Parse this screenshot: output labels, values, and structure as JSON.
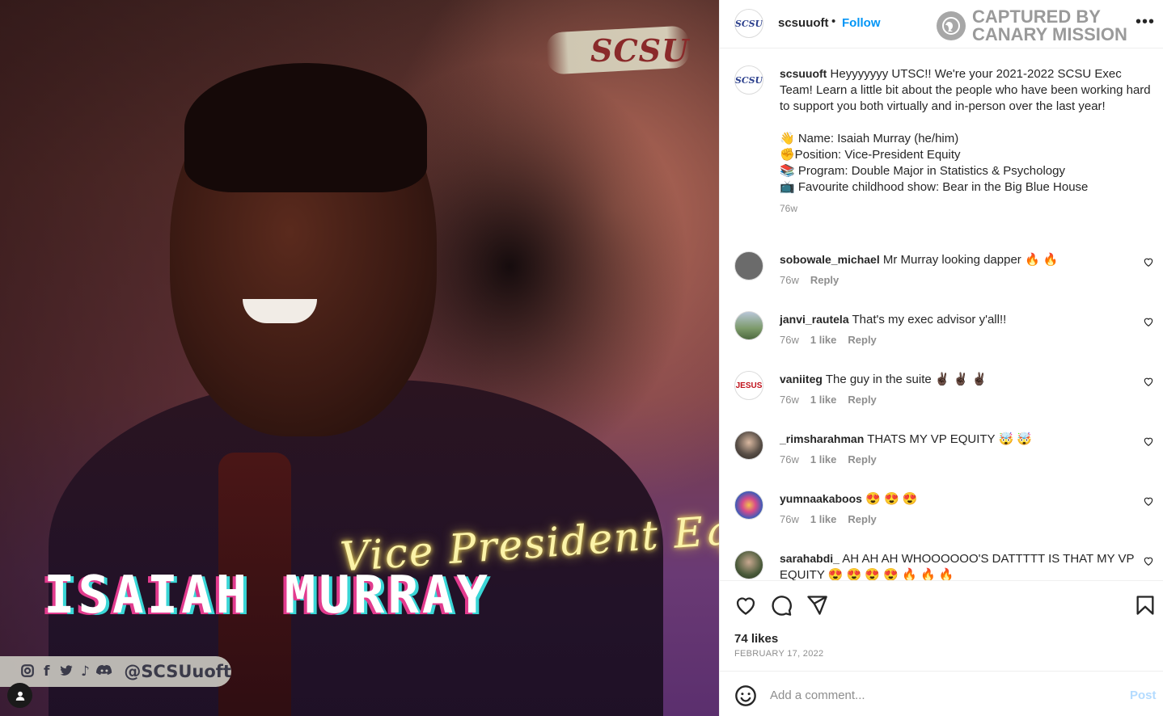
{
  "photo": {
    "logo_text": "SCSU",
    "role_text": "Vice President Equity",
    "name_text": "ISAIAH MURRAY",
    "social_handle": "@SCSUuoft",
    "social_icons": [
      "instagram-icon",
      "facebook-icon",
      "twitter-icon",
      "tiktok-icon",
      "discord-icon"
    ]
  },
  "header": {
    "avatar_text": "SCSU",
    "username": "scsuuoft",
    "separator": "•",
    "follow_label": "Follow",
    "watermark_line1": "CAPTURED BY",
    "watermark_line2": "CANARY MISSION",
    "more_label": "•••"
  },
  "caption": {
    "username": "scsuuoft",
    "text": "Heyyyyyyy UTSC!! We're your 2021-2022 SCSU Exec Team! Learn a little bit about the people who have been working hard to support you both virtually and in-person over the last year!",
    "lines": [
      "👋 Name: Isaiah Murray (he/him)",
      "✊Position: Vice-President Equity",
      "📚 Program: Double Major in Statistics & Psychology",
      "📺 Favourite childhood show: Bear in the Big Blue House"
    ],
    "time": "76w"
  },
  "comments": [
    {
      "username": "sobowale_michael",
      "text": "Mr Murray looking dapper 🔥 🔥",
      "time": "76w",
      "likes": "",
      "reply": "Reply",
      "avatar_color": "#6b6b6b"
    },
    {
      "username": "janvi_rautela",
      "text": "That's my exec advisor y'all!!",
      "time": "76w",
      "likes": "1 like",
      "reply": "Reply",
      "avatar_color": "#7c9a6a"
    },
    {
      "username": "vaniiteg",
      "text": "The guy in the suite ✌🏿 ✌🏿 ✌🏿",
      "time": "76w",
      "likes": "1 like",
      "reply": "Reply",
      "avatar_color": "#ffffff",
      "avatar_text": "JESUS"
    },
    {
      "username": "_rimsharahman",
      "text": "THATS MY VP EQUITY 🤯 🤯",
      "time": "76w",
      "likes": "1 like",
      "reply": "Reply",
      "avatar_color": "#5a5048"
    },
    {
      "username": "yumnaakaboos",
      "text": "😍 😍 😍",
      "time": "76w",
      "likes": "1 like",
      "reply": "Reply",
      "avatar_color": "#3b5bb8"
    },
    {
      "username": "sarahabdi_",
      "text": "AH AH AH WHOOOOOO'S DATTTTT IS THAT MY VP EQUITY 😍 😍 😍 😍 🔥 🔥 🔥",
      "time": "",
      "likes": "",
      "reply": "",
      "avatar_color": "#4a5a3a"
    }
  ],
  "actions": {
    "likes": "74 likes",
    "date": "FEBRUARY 17, 2022"
  },
  "add_comment": {
    "placeholder": "Add a comment...",
    "post_label": "Post"
  }
}
